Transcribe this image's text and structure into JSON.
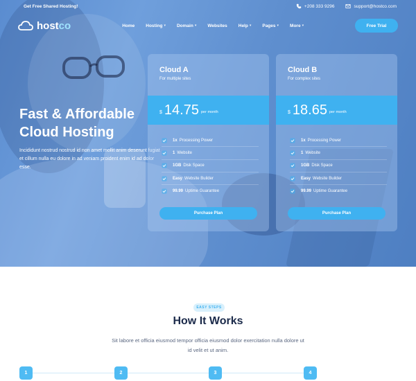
{
  "topbar": {
    "promo": "Get Free Shared Hosting!",
    "phone": "+208 333 9296",
    "email": "support@hostco.com",
    "phone_icon": "phone-icon",
    "email_icon": "mail-icon"
  },
  "brand": {
    "name_part1": "host",
    "name_part2": "co",
    "logo_icon": "cloud-icon",
    "accent_color": "#3fb1f0"
  },
  "nav": {
    "items": [
      {
        "label": "Home",
        "has_dropdown": false
      },
      {
        "label": "Hosting",
        "has_dropdown": true
      },
      {
        "label": "Domain",
        "has_dropdown": true
      },
      {
        "label": "Websites",
        "has_dropdown": false
      },
      {
        "label": "Help",
        "has_dropdown": true
      },
      {
        "label": "Pages",
        "has_dropdown": true
      },
      {
        "label": "More",
        "has_dropdown": true
      }
    ],
    "cta": "Free Trial"
  },
  "hero": {
    "title_line1": "Fast & Affordable",
    "title_line2": "Cloud Hosting",
    "text": "Incididunt nostrud nostrud id non amet mollit anim deserunt fugiat et cillum nulla eu dolore in ad veniam proident enim id ad dolor esse."
  },
  "plans": [
    {
      "name": "Cloud A",
      "subtitle": "For multiple sites",
      "currency": "$",
      "price": "14.75",
      "period": "per month",
      "features": [
        {
          "strong": "1x",
          "text": "Processing Power"
        },
        {
          "strong": "1",
          "text": "Website"
        },
        {
          "strong": "1GB",
          "text": "Disk Space"
        },
        {
          "strong": "Easy",
          "text": "Website Builder"
        },
        {
          "strong": "99.99",
          "text": "Uptime Guarantee"
        }
      ],
      "button": "Purchase Plan"
    },
    {
      "name": "Cloud B",
      "subtitle": "For complex sites",
      "currency": "$",
      "price": "18.65",
      "period": "per month",
      "features": [
        {
          "strong": "1x",
          "text": "Processing Power"
        },
        {
          "strong": "1",
          "text": "Website"
        },
        {
          "strong": "1GB",
          "text": "Disk Space"
        },
        {
          "strong": "Easy",
          "text": "Website Builder"
        },
        {
          "strong": "99.99",
          "text": "Uptime Guarantee"
        }
      ],
      "button": "Purchase Plan"
    }
  ],
  "how": {
    "badge": "EASY STEPS",
    "title": "How It Works",
    "text": "Sit labore et officia eiusmod tempor officia eiusmod dolor exercitation nulla dolore ut id velit et ut anim.",
    "steps": [
      "1",
      "2",
      "3",
      "4"
    ]
  }
}
